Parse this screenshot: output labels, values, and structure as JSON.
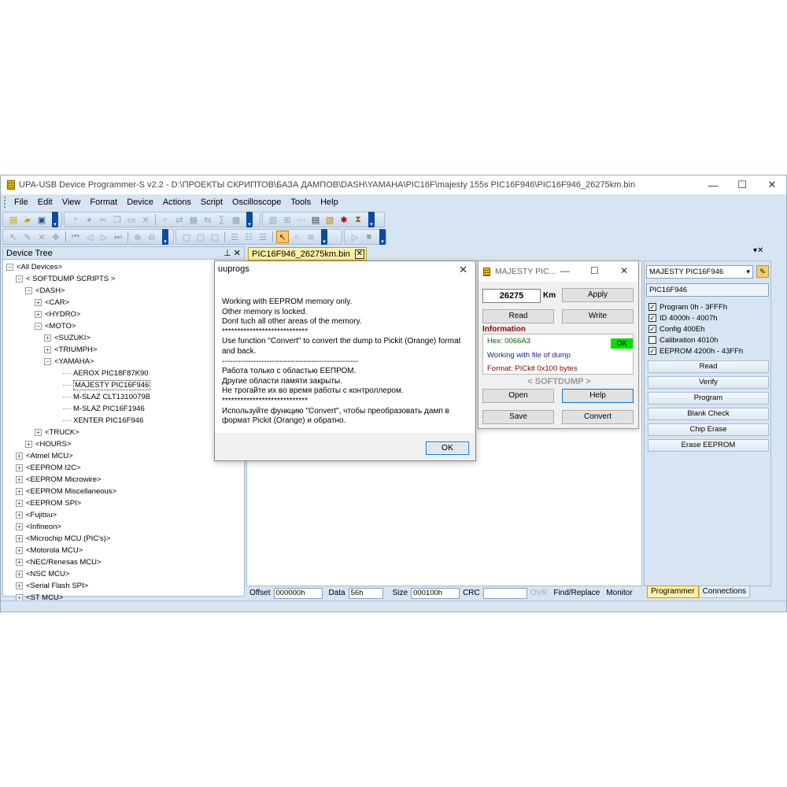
{
  "window": {
    "title": "UPA-USB Device Programmer-S v2.2 - D:\\ПРОЕКТЫ СКРИПТОВ\\БАЗА ДАМПОВ\\DASH\\YAMAHA\\PIC16F\\majesty 155s PIC16F946\\PIC16F946_26275km.bin",
    "minimize": "—",
    "maximize": "☐",
    "close": "✕"
  },
  "menu": [
    "File",
    "Edit",
    "View",
    "Format",
    "Device",
    "Actions",
    "Script",
    "Oscilloscope",
    "Tools",
    "Help"
  ],
  "device_tree": {
    "header": "Device Tree",
    "header_buttons": "⊥ ✕",
    "nodes": [
      {
        "label": "<All Devices>",
        "expander": "⊟"
      },
      {
        "label": "< SOFTDUMP SCRIPTS >",
        "expander": "⊟"
      },
      {
        "label": "<DASH>",
        "expander": "⊟"
      },
      {
        "label": "<CAR>",
        "expander": "⊞"
      },
      {
        "label": "<HYDRO>",
        "expander": "⊞"
      },
      {
        "label": "<MOTO>",
        "expander": "⊟"
      },
      {
        "label": "<SUZUKI>",
        "expander": "⊞"
      },
      {
        "label": "<TRIUMPH>",
        "expander": "⊞"
      },
      {
        "label": "<YAMAHA>",
        "expander": "⊟"
      },
      {
        "label": "AEROX PIC18F87K90",
        "expander": ""
      },
      {
        "label": "MAJESTY PIC16F946",
        "expander": ""
      },
      {
        "label": "M-SLAZ CLT1310079B",
        "expander": ""
      },
      {
        "label": "M-SLAZ PIC16F1946",
        "expander": ""
      },
      {
        "label": "XENTER PIC16F946",
        "expander": ""
      },
      {
        "label": "<TRUCK>",
        "expander": "⊞"
      },
      {
        "label": "<HOURS>",
        "expander": "⊞"
      },
      {
        "label": "<Atmel MCU>",
        "expander": "⊞"
      },
      {
        "label": "<EEPROM I2C>",
        "expander": "⊞"
      },
      {
        "label": "<EEPROM Microwire>",
        "expander": "⊞"
      },
      {
        "label": "<EEPROM Miscellaneous>",
        "expander": "⊞"
      },
      {
        "label": "<EEPROM SPI>",
        "expander": "⊞"
      },
      {
        "label": "<Fujitsu>",
        "expander": "⊞"
      },
      {
        "label": "<Infineon>",
        "expander": "⊞"
      },
      {
        "label": "<Microchip MCU (PIC's)>",
        "expander": "⊞"
      },
      {
        "label": "<Motorola MCU>",
        "expander": "⊞"
      },
      {
        "label": "<NEC/Renesas MCU>",
        "expander": "⊞"
      },
      {
        "label": "<NSC MCU>",
        "expander": "⊞"
      },
      {
        "label": "<Serial Flash SPI>",
        "expander": "⊞"
      },
      {
        "label": "<ST MCU>",
        "expander": "⊞"
      }
    ]
  },
  "editor": {
    "tab_label": "PIC16F946_26275km.bin",
    "tab_close": "✕",
    "panel_buttons": "▾✕"
  },
  "statusbar": {
    "offset_label": "Offset",
    "offset_value": "000000h",
    "data_label": "Data",
    "data_value": "56h",
    "size_label": "Size",
    "size_value": "000100h",
    "crc_label": "CRC",
    "crc_value": "",
    "ovr": "OVR",
    "find_replace": "Find/Replace",
    "monitor": "Monitor"
  },
  "programmer": {
    "device_select": "MAJESTY PIC16F946",
    "select_arrow": "▾",
    "chip": "PIC16F946",
    "checks": [
      {
        "label": "Program 0h - 3FFFh",
        "checked": true
      },
      {
        "label": "ID 4000h - 4007h",
        "checked": true
      },
      {
        "label": "Config 400Eh",
        "checked": true
      },
      {
        "label": "Calibration 4010h",
        "checked": false
      },
      {
        "label": "EEPROM 4200h - 43FFh",
        "checked": true
      }
    ],
    "buttons": [
      "Read",
      "Verify",
      "Program",
      "Blank Check",
      "Chip Erase",
      "Erase EEPROM"
    ],
    "tabs": [
      "Programmer",
      "Connections"
    ]
  },
  "dialog": {
    "title": "uuprogs",
    "close": "✕",
    "lines": [
      "Working with EEPROM memory only.",
      "Other memory is locked.",
      "Dont tuch all other areas of the memory.",
      "****************************",
      "Use function \"Convert\" to convert the dump to Pickit (Orange) format",
      "and back.",
      "----------------------------------------------------",
      "Работа только с областью ЕЕПРОМ.",
      "Другие области памяти закрыты.",
      "Не трогайте их во время работы с контроллером.",
      "****************************",
      "Используйте функцию \"Convert\", чтобы преобразовать дамп в",
      "формат Pickit (Orange) и обратно."
    ],
    "ok": "OK"
  },
  "majesty": {
    "title": "MAJESTY PIC...",
    "minimize": "—",
    "maximize": "☐",
    "close": "✕",
    "km_value": "26275",
    "km_unit": "Km",
    "apply": "Apply",
    "read": "Read",
    "write": "Write",
    "info_label": "Information",
    "hex": "Hex: 0066A3",
    "ok_badge": "OK",
    "working": "Working with file of dump",
    "format": "Format: PICkit 0x100 bytes",
    "brand": "< SOFTDUMP >",
    "open": "Open",
    "help": "Help",
    "save": "Save",
    "convert": "Convert"
  }
}
